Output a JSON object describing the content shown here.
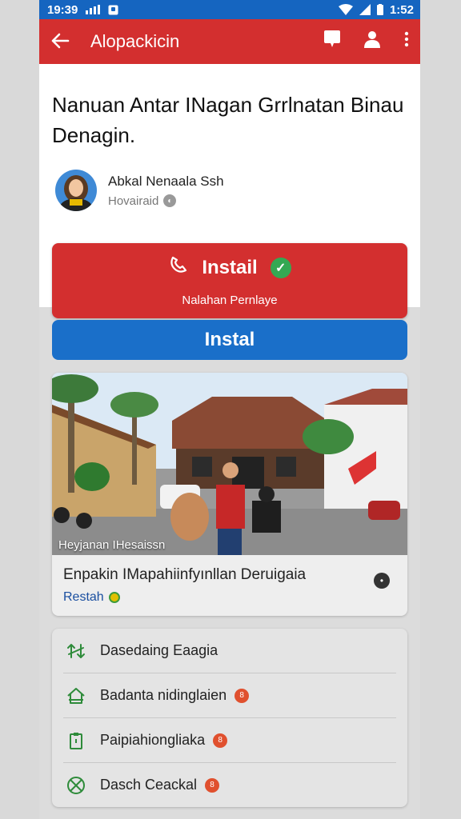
{
  "status": {
    "time": "19:39",
    "right_time": "1:52"
  },
  "appbar": {
    "back_icon": "arrow-left-icon",
    "title": "Alopackicin"
  },
  "article": {
    "headline": "Nanuan Antar INagan Grrlnatan Binau Denagin.",
    "author_name": "Abkal Nenaala Ssh",
    "author_sub": "Hovairaid"
  },
  "install_primary": {
    "label": "Instail",
    "sublabel": "Nalahan Pernlaye"
  },
  "install_secondary": {
    "label": "Instal"
  },
  "news": {
    "photo_caption": "Heyjanan IHesaissn",
    "title": "Enpakin IMapahiinfyınllan Deruigaia",
    "source": "Restah"
  },
  "menu": {
    "items": [
      {
        "label": "Dasedaing Eaagia",
        "icon": "swap-arrows-icon",
        "badge": ""
      },
      {
        "label": "Badanta nidinglaien",
        "icon": "home-icon",
        "badge": "8"
      },
      {
        "label": "Paipiahiongliaka",
        "icon": "clipboard-icon",
        "badge": "8"
      },
      {
        "label": "Dasch Ceackal",
        "icon": "globe-icon",
        "badge": "8"
      }
    ]
  },
  "colors": {
    "accent_red": "#d32f2f",
    "accent_blue": "#1a6fc9",
    "status_blue": "#1565c0"
  }
}
